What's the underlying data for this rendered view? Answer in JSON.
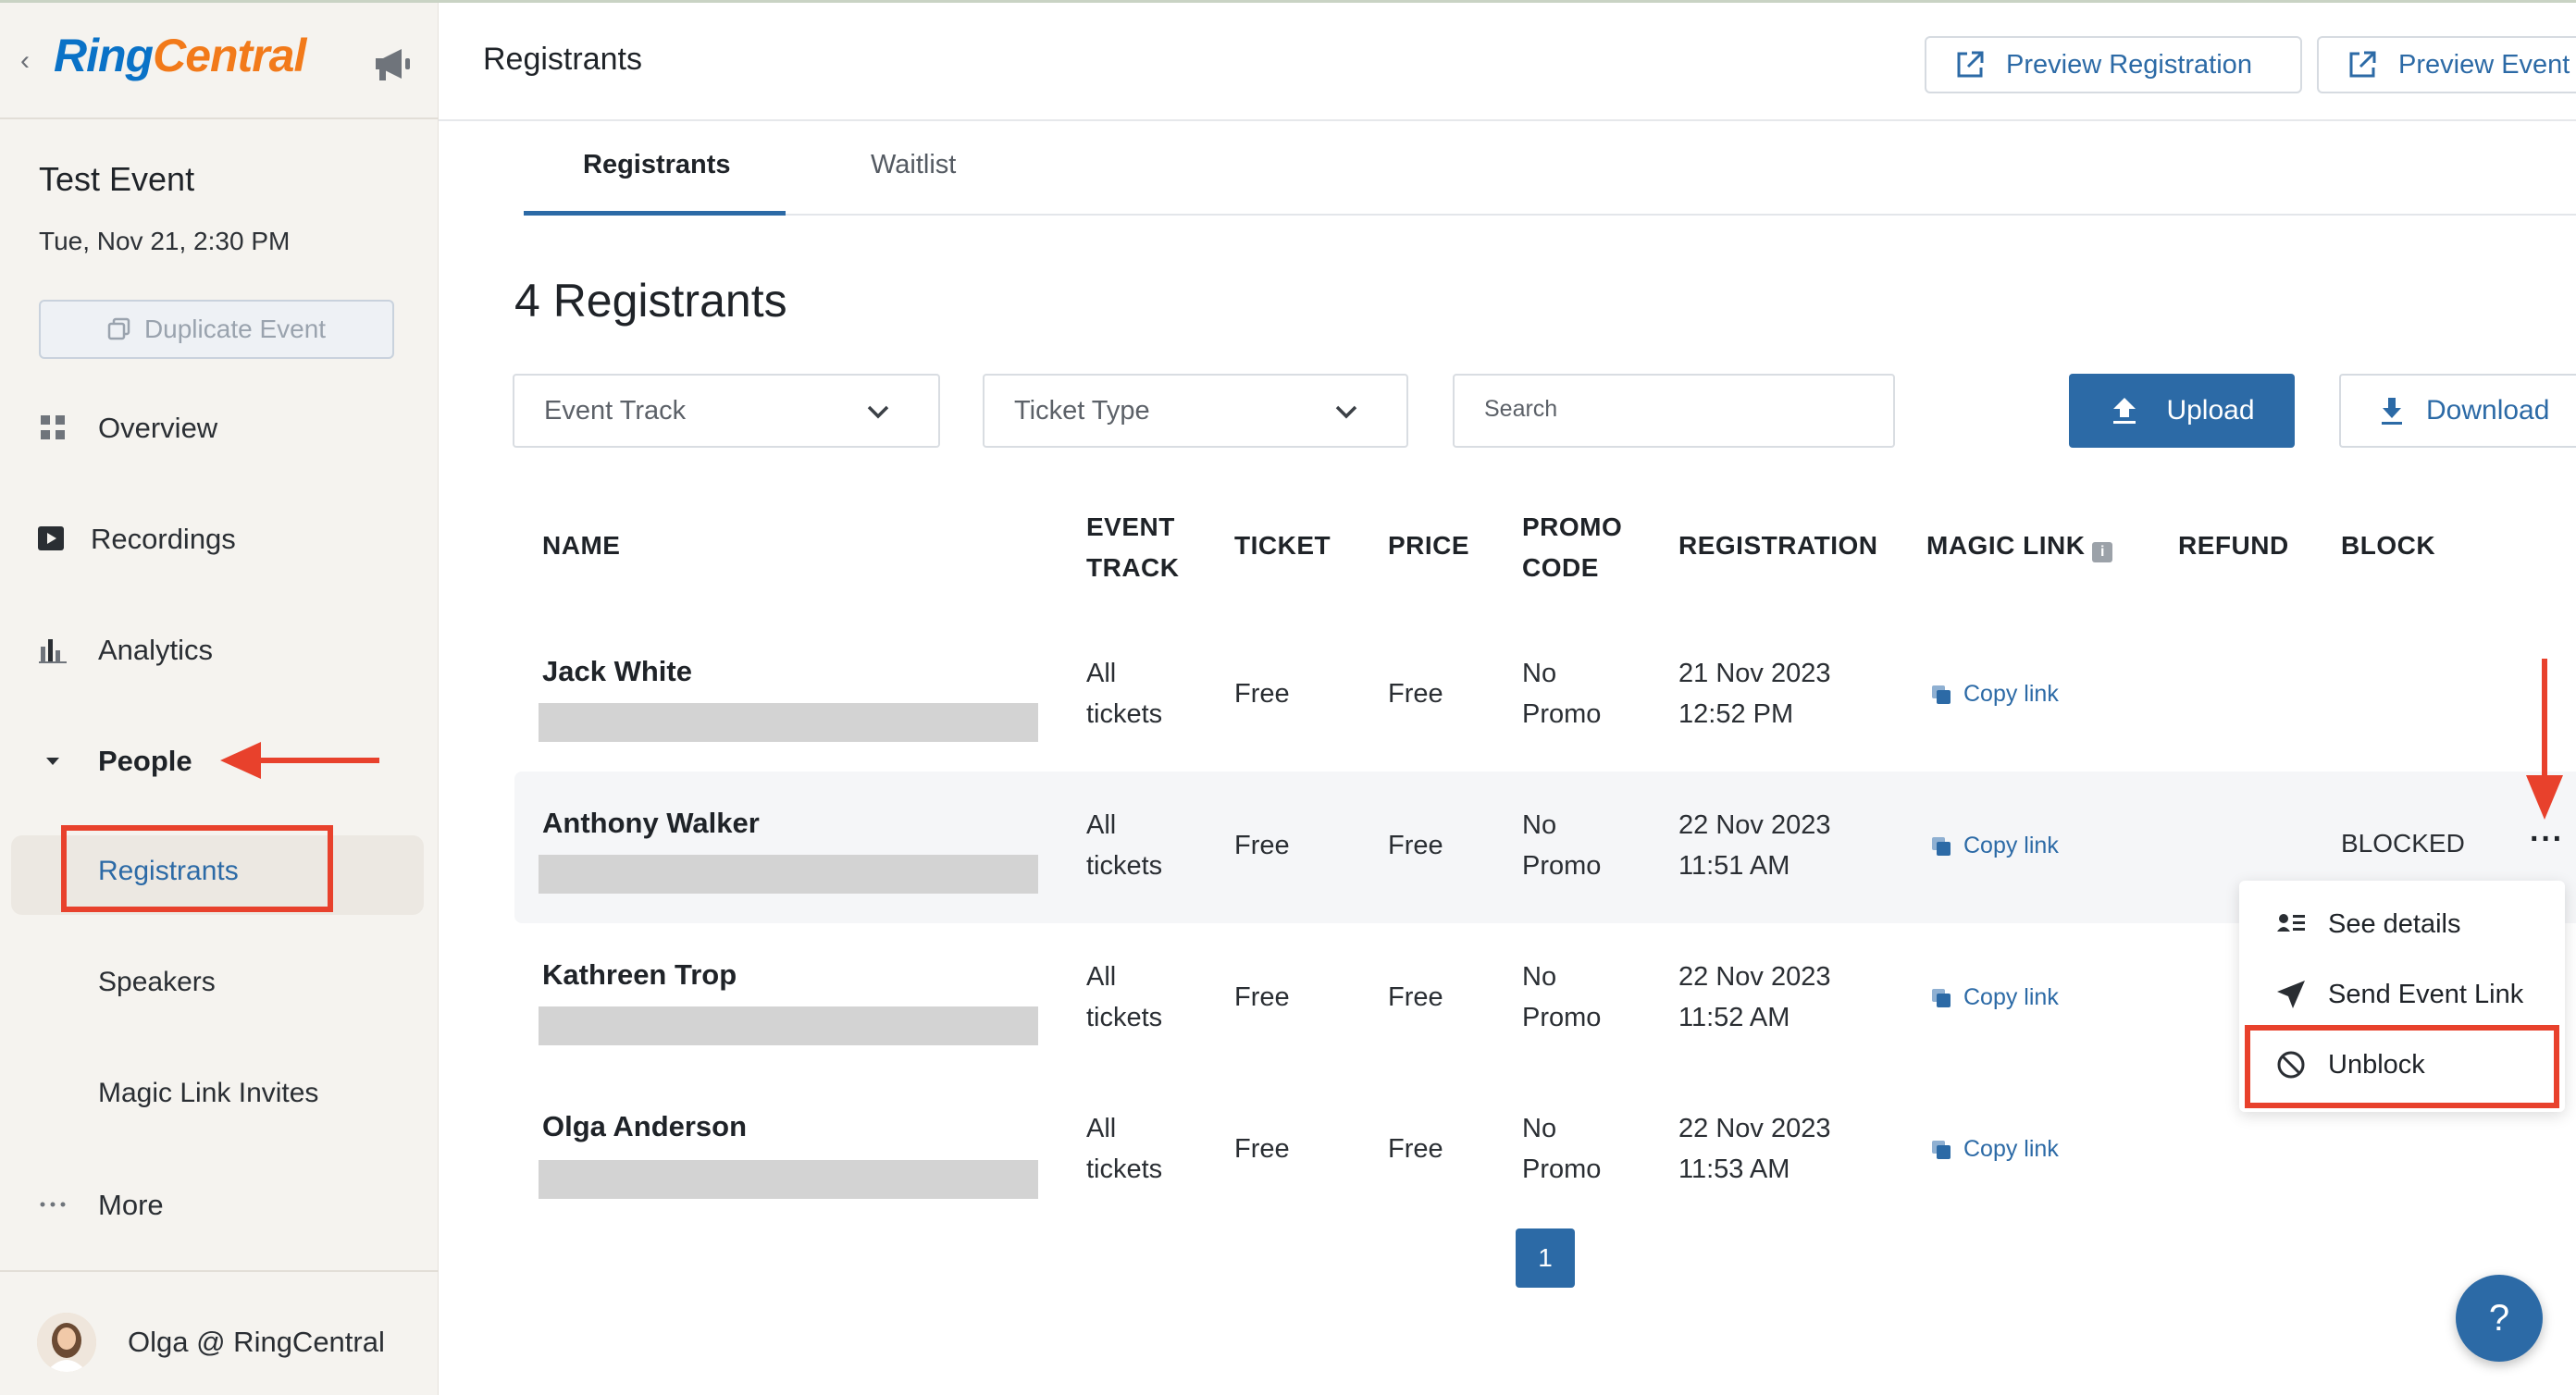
{
  "app": {
    "logo_ring": "Ring",
    "logo_central": "Central"
  },
  "sidebar": {
    "event_name": "Test Event",
    "event_date": "Tue, Nov 21, 2:30 PM",
    "duplicate_label": "Duplicate Event",
    "nav": [
      {
        "label": "Overview",
        "icon": "grid-icon"
      },
      {
        "label": "Recordings",
        "icon": "play-icon"
      },
      {
        "label": "Analytics",
        "icon": "bar-chart-icon"
      },
      {
        "label": "People",
        "icon": "caret-down-icon"
      },
      {
        "label": "More",
        "icon": "more-dots-icon"
      }
    ],
    "people_sub": [
      "Registrants",
      "Speakers",
      "Magic Link Invites"
    ],
    "user_name": "Olga @ RingCentral"
  },
  "header": {
    "title": "Registrants",
    "preview_registration": "Preview Registration",
    "preview_event": "Preview Event"
  },
  "tabs": [
    "Registrants",
    "Waitlist"
  ],
  "main": {
    "count_title": "4 Registrants",
    "filter_event_track": "Event Track",
    "filter_ticket_type": "Ticket Type",
    "search_placeholder": "Search",
    "upload_label": "Upload",
    "download_label": "Download"
  },
  "table": {
    "headers": {
      "name": "NAME",
      "event_track_1": "EVENT",
      "event_track_2": "TRACK",
      "ticket": "TICKET",
      "price": "PRICE",
      "promo_1": "PROMO",
      "promo_2": "CODE",
      "registration": "REGISTRATION",
      "magic_link": "MAGIC LINK",
      "refund": "REFUND",
      "block": "BLOCK"
    },
    "rows": [
      {
        "name": "Jack White",
        "track_1": "All",
        "track_2": "tickets",
        "ticket": "Free",
        "price": "Free",
        "promo_1": "No",
        "promo_2": "Promo",
        "date": "21 Nov 2023",
        "time": "12:52 PM",
        "link": "Copy link",
        "block": ""
      },
      {
        "name": "Anthony Walker",
        "track_1": "All",
        "track_2": "tickets",
        "ticket": "Free",
        "price": "Free",
        "promo_1": "No",
        "promo_2": "Promo",
        "date": "22 Nov 2023",
        "time": "11:51 AM",
        "link": "Copy link",
        "block": "BLOCKED"
      },
      {
        "name": "Kathreen Trop",
        "track_1": "All",
        "track_2": "tickets",
        "ticket": "Free",
        "price": "Free",
        "promo_1": "No",
        "promo_2": "Promo",
        "date": "22 Nov 2023",
        "time": "11:52 AM",
        "link": "Copy link",
        "block": ""
      },
      {
        "name": "Olga Anderson",
        "track_1": "All",
        "track_2": "tickets",
        "ticket": "Free",
        "price": "Free",
        "promo_1": "No",
        "promo_2": "Promo",
        "date": "22 Nov 2023",
        "time": "11:53 AM",
        "link": "Copy link",
        "block": ""
      }
    ]
  },
  "row_menu": [
    "See details",
    "Send Event Link",
    "Unblock"
  ],
  "pagination": {
    "current": "1"
  },
  "help": "?",
  "colors": {
    "accent": "#2c6aa6",
    "annotation": "#e8412c",
    "logo_blue": "#0a72c7",
    "logo_orange": "#f27a1a"
  }
}
